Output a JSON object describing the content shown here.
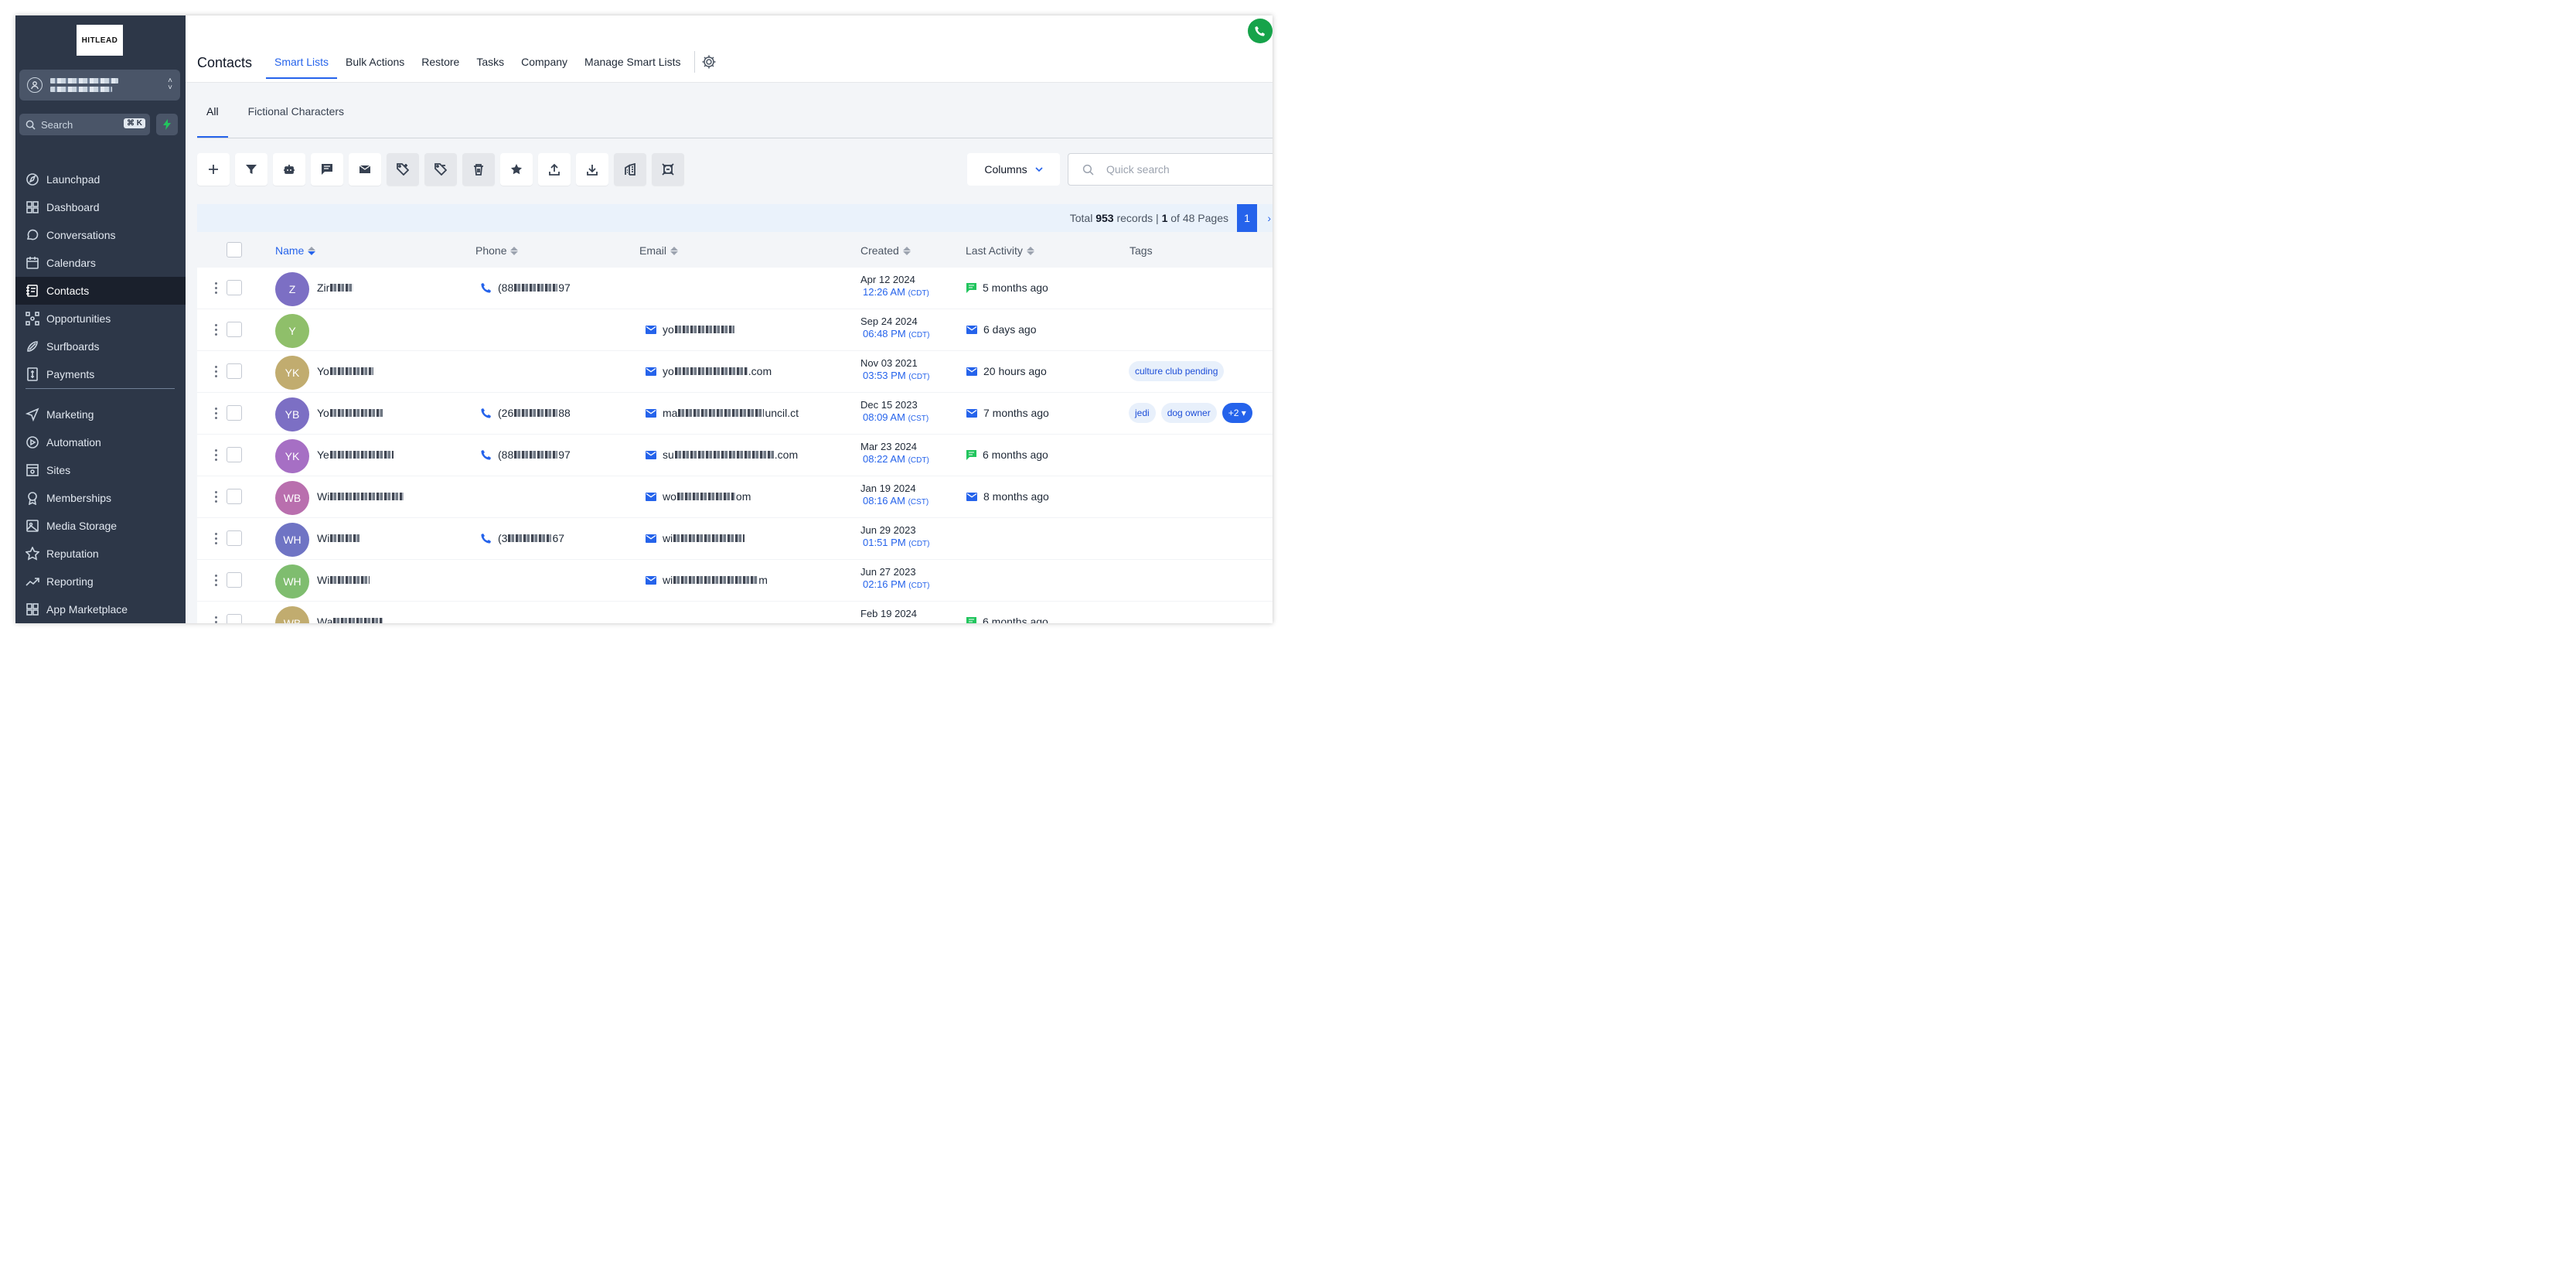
{
  "brand": {
    "logo_text": "HITLEAD"
  },
  "account": {
    "chevron": "⌃⌄"
  },
  "sidebar": {
    "search_label": "Search",
    "search_shortcut": "⌘ K",
    "items": [
      {
        "label": "Launchpad",
        "icon": "launchpad-icon"
      },
      {
        "label": "Dashboard",
        "icon": "dashboard-icon"
      },
      {
        "label": "Conversations",
        "icon": "chat-icon"
      },
      {
        "label": "Calendars",
        "icon": "calendar-icon"
      },
      {
        "label": "Contacts",
        "icon": "contacts-icon",
        "active": true
      },
      {
        "label": "Opportunities",
        "icon": "opportunities-icon"
      },
      {
        "label": "Surfboards",
        "icon": "surfboard-icon"
      },
      {
        "label": "Payments",
        "icon": "payments-icon"
      }
    ],
    "items2": [
      {
        "label": "Marketing",
        "icon": "send-icon"
      },
      {
        "label": "Automation",
        "icon": "automation-icon"
      },
      {
        "label": "Sites",
        "icon": "sites-icon"
      },
      {
        "label": "Memberships",
        "icon": "membership-icon"
      },
      {
        "label": "Media Storage",
        "icon": "image-icon"
      },
      {
        "label": "Reputation",
        "icon": "star-icon"
      },
      {
        "label": "Reporting",
        "icon": "chart-icon"
      },
      {
        "label": "App Marketplace",
        "icon": "apps-icon"
      }
    ]
  },
  "header": {
    "title": "Contacts",
    "tabs": [
      "Smart Lists",
      "Bulk Actions",
      "Restore",
      "Tasks",
      "Company",
      "Manage Smart Lists"
    ]
  },
  "subtabs": [
    "All",
    "Fictional Characters"
  ],
  "toolbar": {
    "columns_label": "Columns",
    "search_placeholder": "Quick search"
  },
  "records": {
    "prefix": "Total ",
    "total": "953",
    "middle": " records | ",
    "page": "1",
    "suffix": " of 48 Pages",
    "current_page": "1",
    "next": "›"
  },
  "table": {
    "headers": {
      "name": "Name",
      "phone": "Phone",
      "email": "Email",
      "created": "Created",
      "activity": "Last Activity",
      "tags": "Tags"
    },
    "rows": [
      {
        "initials": "Z",
        "color": "#7c6fc4",
        "name": "Zir",
        "phone_start": "(88",
        "phone_end": "97",
        "email_start": "",
        "email_end": "",
        "date": "Apr 12 2024",
        "time": "12:26 AM",
        "tz": "(CDT)",
        "activity_icon": "chat",
        "activity": "5 months ago",
        "tags": []
      },
      {
        "initials": "Y",
        "color": "#8fbf6a",
        "name": "",
        "phone_start": "",
        "phone_end": "",
        "email_start": "yo",
        "email_end": "",
        "date": "Sep 24 2024",
        "time": "06:48 PM",
        "tz": "(CDT)",
        "activity_icon": "email",
        "activity": "6 days ago",
        "tags": []
      },
      {
        "initials": "YK",
        "color": "#c1ac6f",
        "name": "Yo",
        "phone_start": "",
        "phone_end": "",
        "email_start": "yo",
        "email_end": ".com",
        "date": "Nov 03 2021",
        "time": "03:53 PM",
        "tz": "(CDT)",
        "activity_icon": "email",
        "activity": "20 hours ago",
        "tags": [
          "culture club pending"
        ]
      },
      {
        "initials": "YB",
        "color": "#7c6fc4",
        "name": "Yo",
        "phone_start": "(26",
        "phone_end": "88",
        "email_start": "ma",
        "email_end": "uncil.ct",
        "date": "Dec 15 2023",
        "time": "08:09 AM",
        "tz": "(CST)",
        "activity_icon": "email",
        "activity": "7 months ago",
        "tags": [
          "jedi",
          "dog owner"
        ],
        "more_tags": "+2"
      },
      {
        "initials": "YK",
        "color": "#a66fc4",
        "name": "Ye",
        "phone_start": "(88",
        "phone_end": "97",
        "email_start": "su",
        "email_end": ".com",
        "date": "Mar 23 2024",
        "time": "08:22 AM",
        "tz": "(CDT)",
        "activity_icon": "chat",
        "activity": "6 months ago",
        "tags": []
      },
      {
        "initials": "WB",
        "color": "#b96fae",
        "name": "Wi",
        "phone_start": "",
        "phone_end": "",
        "email_start": "wo",
        "email_end": "om",
        "date": "Jan 19 2024",
        "time": "08:16 AM",
        "tz": "(CST)",
        "activity_icon": "email",
        "activity": "8 months ago",
        "tags": []
      },
      {
        "initials": "WH",
        "color": "#6f74c4",
        "name": "Wi",
        "phone_start": "(3",
        "phone_end": "67",
        "email_start": "wi",
        "email_end": "",
        "date": "Jun 29 2023",
        "time": "01:51 PM",
        "tz": "(CDT)",
        "activity_icon": "",
        "activity": "",
        "tags": []
      },
      {
        "initials": "WH",
        "color": "#7fbd6f",
        "name": "Wi",
        "phone_start": "",
        "phone_end": "",
        "email_start": "wi",
        "email_end": "m",
        "date": "Jun 27 2023",
        "time": "02:16 PM",
        "tz": "(CDT)",
        "activity_icon": "",
        "activity": "",
        "tags": []
      },
      {
        "initials": "WB",
        "color": "#c1ac6f",
        "name": "Wa",
        "phone_start": "",
        "phone_end": "",
        "email_start": "",
        "email_end": "",
        "date": "Feb 19 2024",
        "time": "",
        "tz": "",
        "activity_icon": "chat",
        "activity": "6 months ago",
        "tags": []
      }
    ]
  },
  "colors": {
    "sidebar": "#2d3748",
    "accent": "#2563eb",
    "call": "#16a34a",
    "chat": "#22c55e"
  }
}
